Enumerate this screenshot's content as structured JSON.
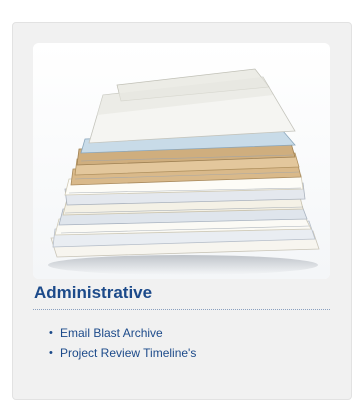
{
  "section": {
    "title": "Administrative",
    "image_subject": "stack of paper files and folders",
    "accent_color": "#1c4a8a",
    "links": [
      {
        "label": "Email Blast Archive"
      },
      {
        "label": "Project Review Timeline's"
      }
    ]
  }
}
